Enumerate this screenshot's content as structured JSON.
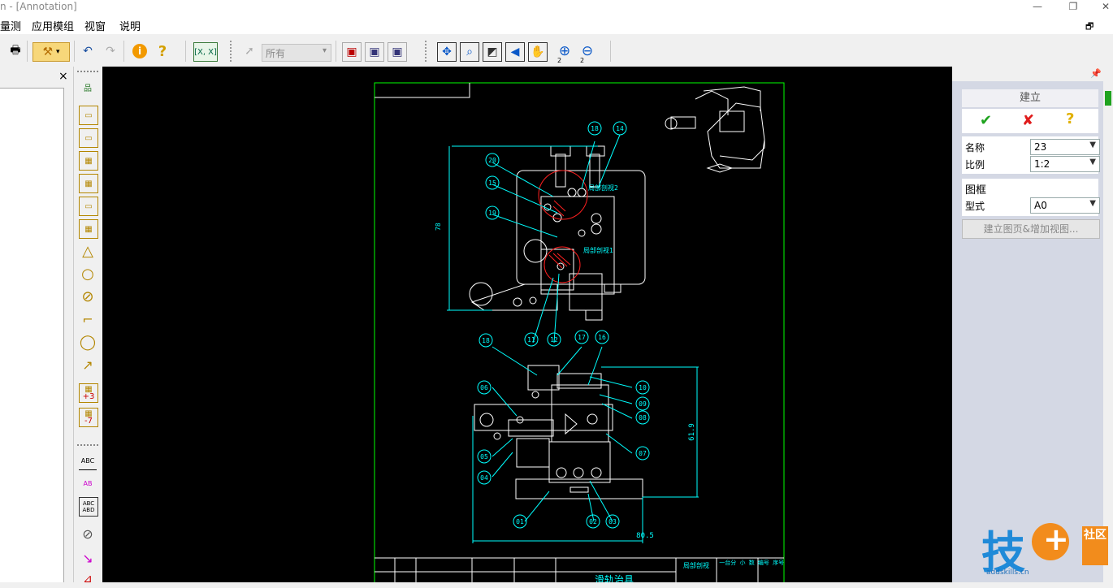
{
  "window": {
    "title": "n - [Annotation]"
  },
  "menu": {
    "items": [
      "量测",
      "应用模组",
      "视窗",
      "说明"
    ]
  },
  "toolbar": {
    "filter_value": "所有",
    "coord_label": "X, X",
    "zoom_in_sub": "2",
    "zoom_out_sub": "2"
  },
  "left_panel": {
    "close_label": "×"
  },
  "left_toolbar": {
    "labels": [
      "ABC",
      "AB",
      "ABC ABD",
      "+3",
      "-7"
    ]
  },
  "drawing": {
    "dimensions": {
      "width": "80.5",
      "height": "61.9",
      "side_height": "78"
    },
    "section_labels": [
      "局部剖视2",
      "局部剖视1"
    ],
    "balloons_top": [
      "18",
      "14",
      "20",
      "15",
      "19",
      "11",
      "12"
    ],
    "balloons_bottom": [
      "18",
      "17",
      "16",
      "10",
      "09",
      "08",
      "06",
      "05",
      "04",
      "07",
      "01",
      "02",
      "03"
    ],
    "sub_labels": [
      "12",
      "12",
      "12",
      "12"
    ],
    "title_block": {
      "title": "滑轨治具",
      "cells": [
        "局部剖视",
        "一台分 小 数",
        "编号 序号"
      ]
    }
  },
  "right_panel": {
    "header": "建立",
    "name_label": "名称",
    "name_value": "23",
    "scale_label": "比例",
    "scale_value": "1:2",
    "frame_section": "图框",
    "style_label": "型式",
    "style_value": "A0",
    "create_button": "建立图页&增加视图..."
  },
  "watermark": {
    "text": "技",
    "sub": "社区",
    "url": "addskills.cn"
  },
  "colors": {
    "drawing_line": "#ffffff",
    "dimension": "#00ffff",
    "border": "#00ff00",
    "hatch": "#ff2020"
  }
}
